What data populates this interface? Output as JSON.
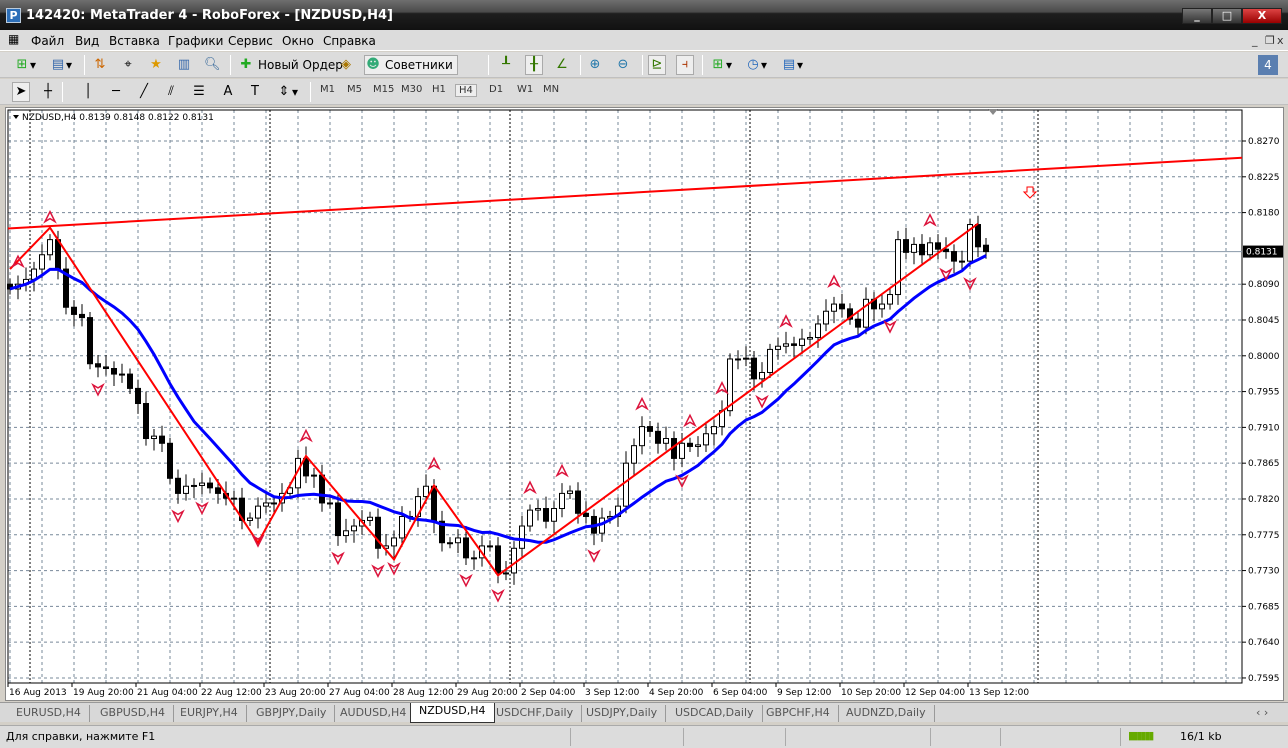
{
  "window": {
    "title": "142420: MetaTrader 4 - RoboForex - [NZDUSD,H4]",
    "minimize": "_",
    "maximize": "□",
    "close": "X"
  },
  "menu": [
    "Файл",
    "Вид",
    "Вставка",
    "Графики",
    "Сервис",
    "Окно",
    "Справка"
  ],
  "mdi_controls": {
    "minimize": "_",
    "restore": "❐",
    "close": "x"
  },
  "toolbar": {
    "new_order": "Новый Ордер",
    "experts": "Советники",
    "notifications_count": "4"
  },
  "timeframes": [
    "M1",
    "M5",
    "M15",
    "M30",
    "H1",
    "H4",
    "D1",
    "W1",
    "MN"
  ],
  "active_timeframe": "H4",
  "chart": {
    "info": "NZDUSD,H4  0.8139 0.8148 0.8122 0.8131",
    "current_price": "0.8131",
    "price_labels": [
      "0.8270",
      "0.8225",
      "0.8180",
      "0.8090",
      "0.8045",
      "0.8000",
      "0.7955",
      "0.7910",
      "0.7865",
      "0.7820",
      "0.7775",
      "0.7730",
      "0.7685",
      "0.7640",
      "0.7595"
    ],
    "time_labels": [
      "16 Aug 2013",
      "19 Aug 20:00",
      "21 Aug 04:00",
      "22 Aug 12:00",
      "23 Aug 20:00",
      "27 Aug 04:00",
      "28 Aug 12:00",
      "29 Aug 20:00",
      "2 Sep 04:00",
      "3 Sep 12:00",
      "4 Sep 20:00",
      "6 Sep 04:00",
      "9 Sep 12:00",
      "10 Sep 20:00",
      "12 Sep 04:00",
      "13 Sep 12:00"
    ],
    "colors": {
      "bull": "#ffffff",
      "bear": "#000000",
      "ma": "#0000ff",
      "zigzag": "#ff0000",
      "trendline": "#ff0000",
      "fractal": "#dc143c",
      "grid": "#778899"
    }
  },
  "chart_data": {
    "type": "candlestick",
    "symbol": "NZDUSD",
    "timeframe": "H4",
    "ylim": [
      0.7595,
      0.829
    ],
    "close": [
      0.8084,
      0.809,
      0.8096,
      0.8109,
      0.8127,
      0.8146,
      0.8109,
      0.8061,
      0.8052,
      0.8048,
      0.799,
      0.7986,
      0.7984,
      0.7977,
      0.7977,
      0.7959,
      0.794,
      0.7896,
      0.7899,
      0.789,
      0.7846,
      0.7827,
      0.7836,
      0.7837,
      0.784,
      0.7834,
      0.7827,
      0.7821,
      0.7821,
      0.7793,
      0.7796,
      0.7811,
      0.7815,
      0.7815,
      0.7827,
      0.7834,
      0.7871,
      0.7849,
      0.785,
      0.7815,
      0.7815,
      0.7774,
      0.778,
      0.7786,
      0.7793,
      0.7797,
      0.7758,
      0.7761,
      0.7771,
      0.7798,
      0.7798,
      0.7823,
      0.7836,
      0.7792,
      0.7765,
      0.7765,
      0.7771,
      0.7746,
      0.7746,
      0.7761,
      0.7761,
      0.7727,
      0.7727,
      0.7758,
      0.7786,
      0.7806,
      0.7808,
      0.7792,
      0.7808,
      0.7827,
      0.783,
      0.7802,
      0.7798,
      0.7777,
      0.7796,
      0.7798,
      0.7811,
      0.7865,
      0.7887,
      0.7911,
      0.7905,
      0.789,
      0.7896,
      0.7871,
      0.789,
      0.7886,
      0.7888,
      0.7902,
      0.7911,
      0.7931,
      0.7996,
      0.7996,
      0.7997,
      0.7971,
      0.7979,
      0.8008,
      0.8012,
      0.8015,
      0.8013,
      0.8021,
      0.8023,
      0.804,
      0.8056,
      0.8065,
      0.8059,
      0.8046,
      0.8036,
      0.8071,
      0.8059,
      0.8065,
      0.8077,
      0.8146,
      0.813,
      0.814,
      0.8127,
      0.8142,
      0.8134,
      0.8131,
      0.8119,
      0.8119,
      0.8165,
      0.8137,
      0.8131
    ],
    "last_bar": {
      "open": 0.8139,
      "high": 0.8148,
      "low": 0.8122,
      "close": 0.8131
    },
    "ma_period": 14,
    "zigzag": [
      [
        0,
        0.8109
      ],
      [
        5,
        0.8161
      ],
      [
        31,
        0.7765
      ],
      [
        37,
        0.7874
      ],
      [
        48,
        0.7744
      ],
      [
        53,
        0.7837
      ],
      [
        61,
        0.7724
      ],
      [
        121,
        0.8166
      ]
    ],
    "trendline": [
      [
        0,
        0.816
      ],
      [
        154,
        0.8249
      ]
    ],
    "fractals_up": [
      1,
      5,
      37,
      53,
      65,
      69,
      79,
      85,
      89,
      97,
      103,
      115
    ],
    "fractals_down": [
      11,
      21,
      24,
      31,
      41,
      46,
      48,
      57,
      61,
      73,
      84,
      94,
      110,
      117,
      120
    ],
    "period_separators": [
      3,
      33,
      63,
      93,
      129
    ]
  },
  "tabs": [
    "EURUSD,H4",
    "GBPUSD,H4",
    "EURJPY,H4",
    "GBPJPY,Daily",
    "AUDUSD,H4",
    "NZDUSD,H4",
    "USDCHF,Daily",
    "USDJPY,Daily",
    "USDCAD,Daily",
    "GBPCHF,H4",
    "AUDNZD,Daily"
  ],
  "active_tab": "NZDUSD,H4",
  "status": {
    "help": "Для справки, нажмите F1",
    "traffic": "16/1 kb"
  }
}
